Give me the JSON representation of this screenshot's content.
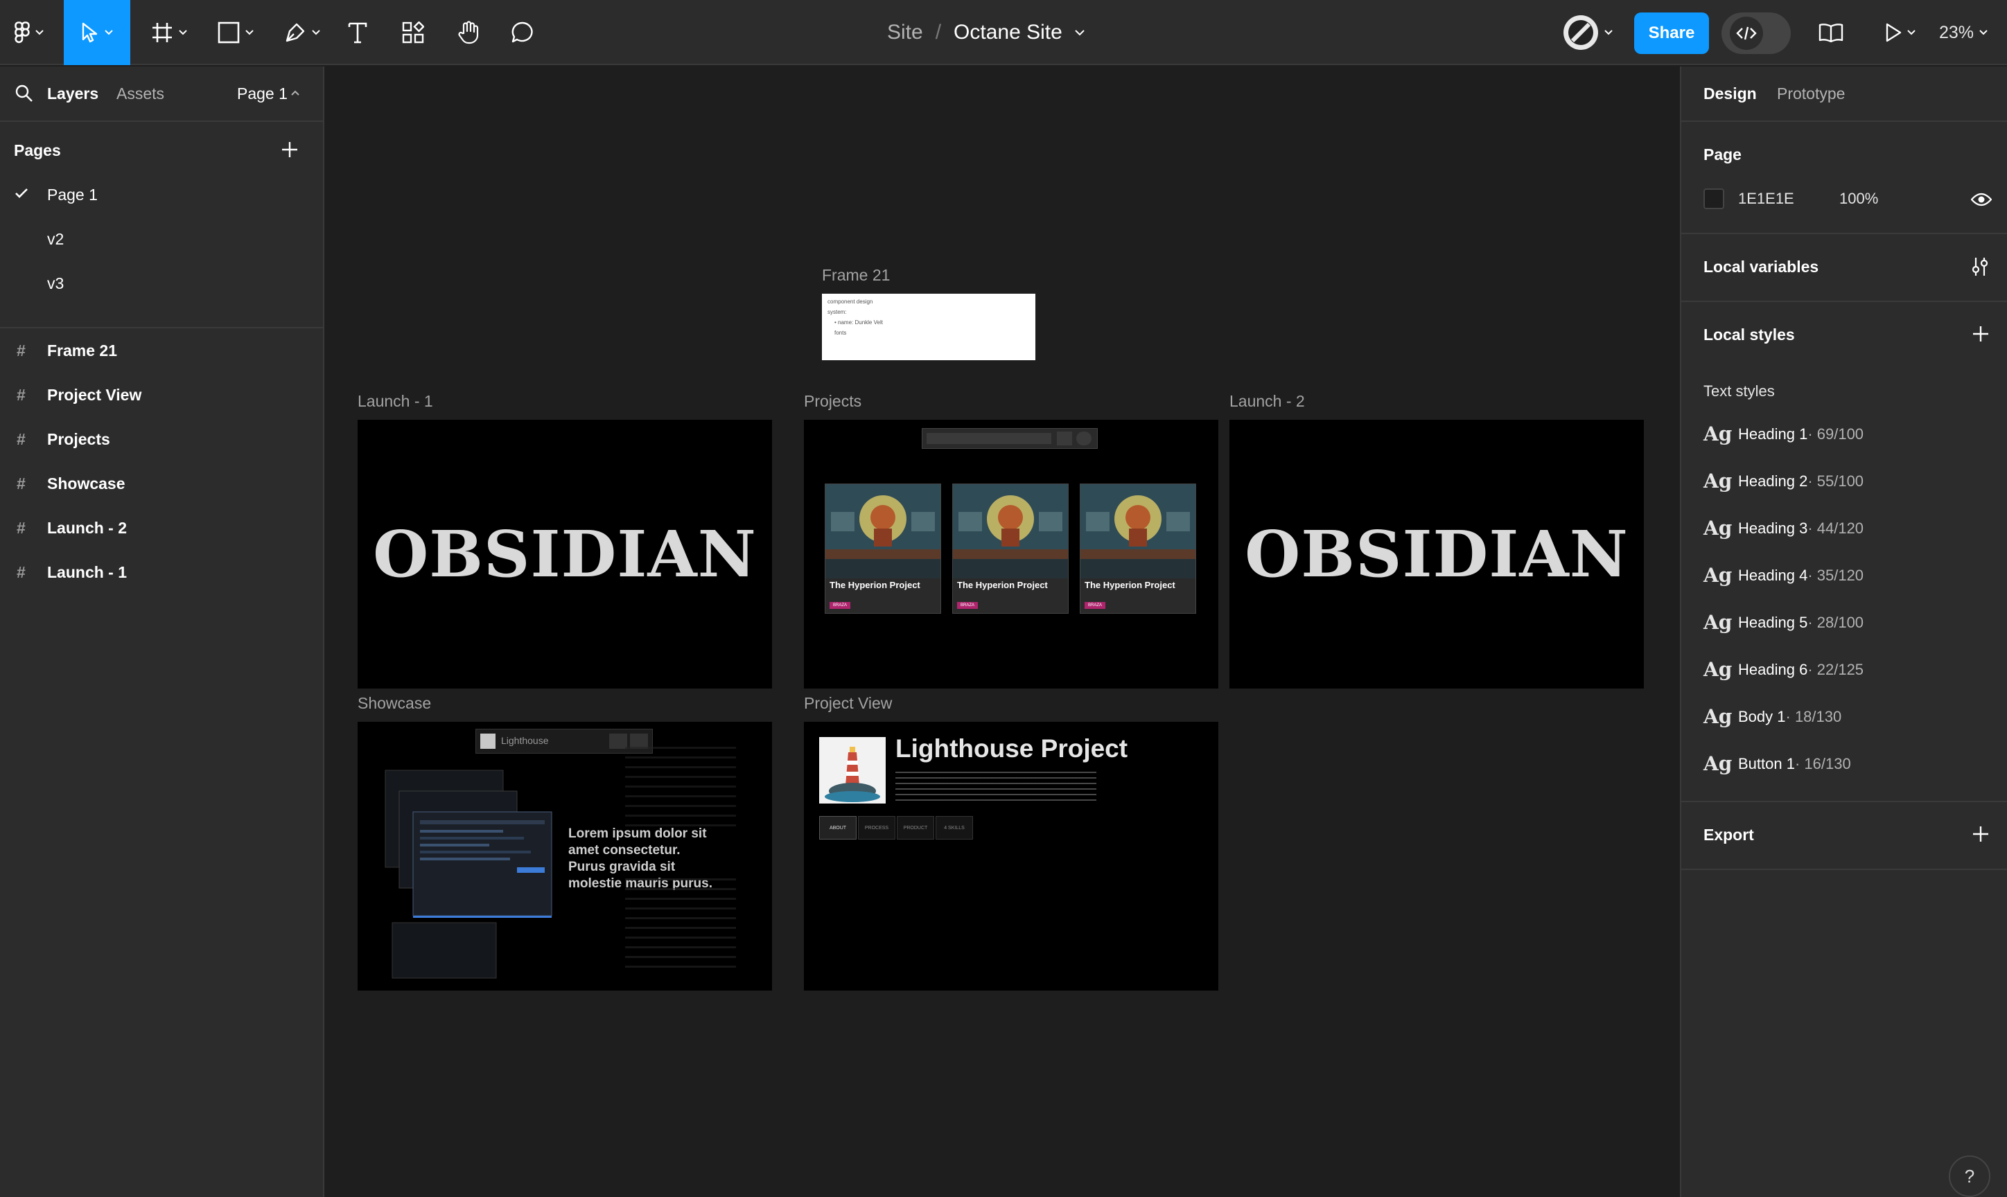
{
  "toolbar": {
    "breadcrumb_project": "Site",
    "breadcrumb_separator": "/",
    "file_name": "Octane Site",
    "share_label": "Share",
    "zoom": "23%"
  },
  "left_panel": {
    "tabs": {
      "layers": "Layers",
      "assets": "Assets"
    },
    "current_page": "Page 1",
    "pages_heading": "Pages",
    "pages": [
      {
        "label": "Page 1",
        "selected": true
      },
      {
        "label": "v2",
        "selected": false
      },
      {
        "label": "v3",
        "selected": false
      }
    ],
    "layers": [
      {
        "label": "Frame 21"
      },
      {
        "label": "Project View"
      },
      {
        "label": "Projects"
      },
      {
        "label": "Showcase"
      },
      {
        "label": "Launch - 2"
      },
      {
        "label": "Launch - 1"
      }
    ]
  },
  "right_panel": {
    "tabs": {
      "design": "Design",
      "prototype": "Prototype"
    },
    "page_heading": "Page",
    "page_color": "1E1E1E",
    "page_opacity": "100%",
    "local_variables": "Local variables",
    "local_styles": "Local styles",
    "text_styles_heading": "Text styles",
    "text_styles": [
      {
        "ag": "Ag",
        "name": "Heading 1",
        "value": " · 69/100"
      },
      {
        "ag": "Ag",
        "name": "Heading 2",
        "value": " · 55/100"
      },
      {
        "ag": "Ag",
        "name": "Heading 3",
        "value": " · 44/120"
      },
      {
        "ag": "Ag",
        "name": "Heading 4",
        "value": " · 35/120"
      },
      {
        "ag": "Ag",
        "name": "Heading 5",
        "value": " · 28/100"
      },
      {
        "ag": "Ag",
        "name": "Heading 6",
        "value": " · 22/125"
      },
      {
        "ag": "Ag",
        "name": "Body 1",
        "value": " · 18/130"
      },
      {
        "ag": "Ag",
        "name": "Button 1",
        "value": " · 16/130"
      }
    ],
    "export": "Export"
  },
  "help": "?",
  "canvas": {
    "frame21": {
      "label": "Frame 21",
      "lines": [
        "component design",
        "system:",
        "• name: Dunkle Velt",
        "fonts"
      ]
    },
    "launch1": {
      "label": "Launch - 1",
      "wordmark": "OBSIDIAN"
    },
    "projects": {
      "label": "Projects",
      "card_title": "The Hyperion Project",
      "card_tag": "BRAZA"
    },
    "launch2": {
      "label": "Launch - 2",
      "wordmark": "OBSIDIAN"
    },
    "showcase": {
      "label": "Showcase",
      "search_text": "Lighthouse",
      "headline": [
        "Lorem ipsum dolor sit",
        "amet consectetur.",
        "Purus gravida sit",
        "molestie mauris purus."
      ]
    },
    "project_view": {
      "label": "Project View",
      "title": "Lighthouse Project",
      "tabs": [
        "ABOUT",
        "PROCESS",
        "PRODUCT",
        "4 SKILLS"
      ]
    }
  },
  "colors": {
    "accent": "#0d99ff",
    "canvas_bg": "#1e1e1e",
    "panel_bg": "#2c2c2c",
    "tag": "#b0246e"
  }
}
